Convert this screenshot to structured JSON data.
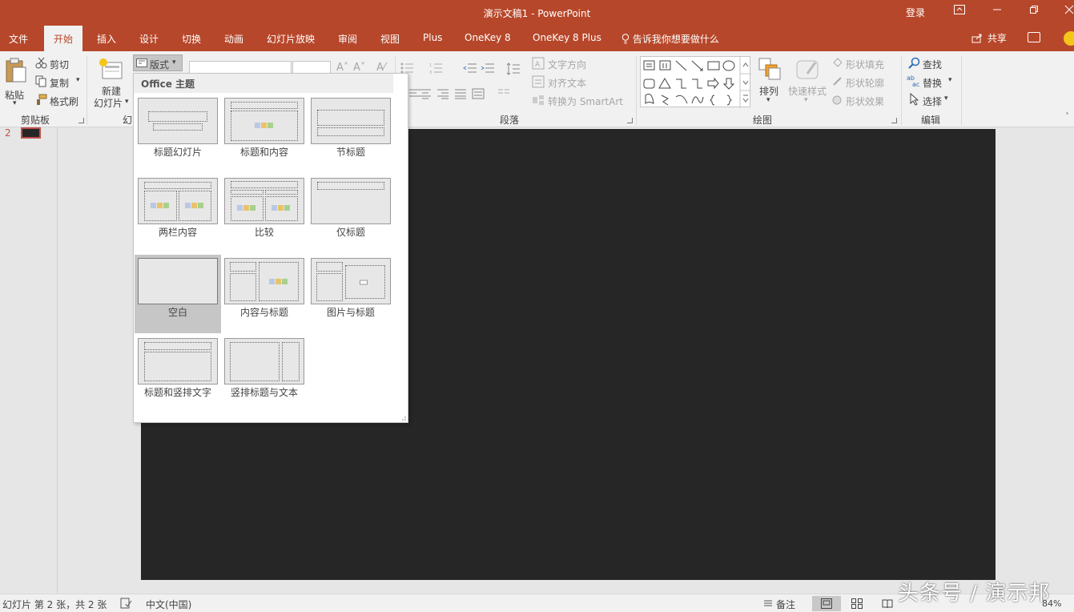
{
  "titlebar": {
    "title": "演示文稿1  -  PowerPoint",
    "login": "登录"
  },
  "tabs": [
    "文件",
    "开始",
    "插入",
    "设计",
    "切换",
    "动画",
    "幻灯片放映",
    "审阅",
    "视图",
    "Plus",
    "OneKey 8",
    "OneKey 8 Plus"
  ],
  "active_tab": "开始",
  "tell_me": "告诉我你想要做什么",
  "share": "共享",
  "clipboard": {
    "paste": "粘贴",
    "cut": "剪切",
    "copy": "复制",
    "format_painter": "格式刷",
    "group_label": "剪贴板"
  },
  "slides_group": {
    "new_slide_line1": "新建",
    "new_slide_line2": "幻灯片",
    "layout_button": "版式",
    "group_label_partial": "幻"
  },
  "paragraph": {
    "text_direction": "文字方向",
    "align_text": "对齐文本",
    "convert_smartart": "转换为 SmartArt",
    "group_label": "段落"
  },
  "drawing": {
    "arrange": "排列",
    "quick_styles": "快速样式",
    "shape_fill": "形状填充",
    "shape_outline": "形状轮廓",
    "shape_effects": "形状效果",
    "group_label": "绘图"
  },
  "editing": {
    "find": "查找",
    "replace": "替换",
    "select": "选择",
    "group_label": "编辑"
  },
  "thumbnail": {
    "number": "2"
  },
  "layout_dropdown": {
    "header": "Office 主题",
    "items": [
      "标题幻灯片",
      "标题和内容",
      "节标题",
      "两栏内容",
      "比较",
      "仅标题",
      "空白",
      "内容与标题",
      "图片与标题",
      "标题和竖排文字",
      "竖排标题与文本"
    ],
    "selected": "空白"
  },
  "statusbar": {
    "slide_info": "幻灯片 第 2 张，共 2 张",
    "language": "中文(中国)",
    "notes": "备注",
    "zoom": "84%"
  },
  "watermark": "头条号 / 演示邦",
  "colors": {
    "accent": "#b7472a",
    "ribbon_bg": "#f1f1f1",
    "slide_bg": "#262626",
    "selected_item": "#c6c6c6"
  }
}
